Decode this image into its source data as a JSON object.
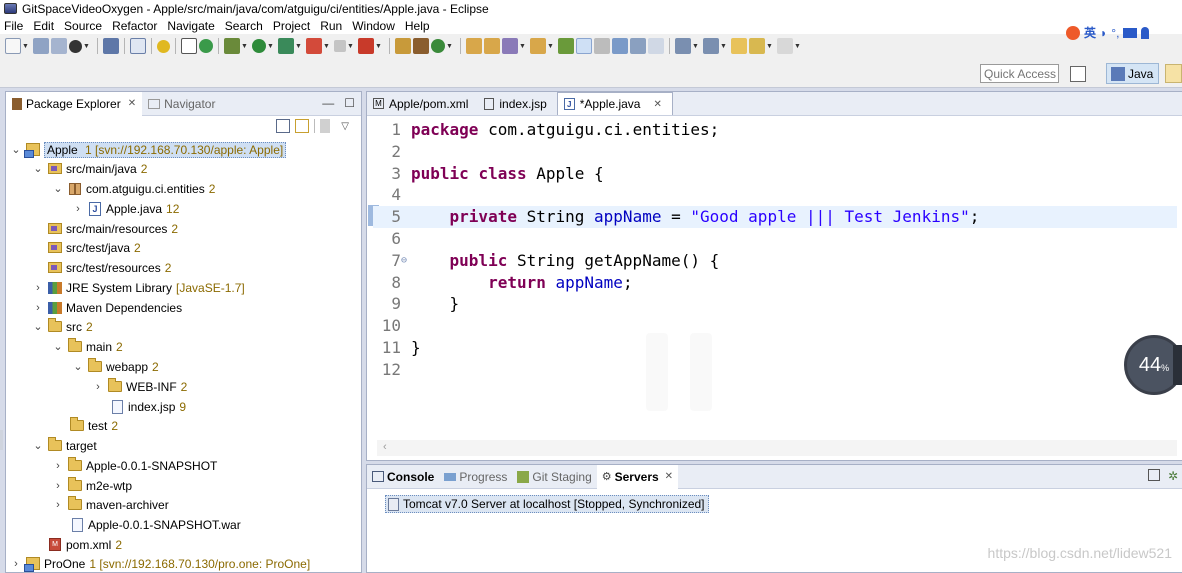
{
  "window": {
    "title": "GitSpaceVideoOxygen - Apple/src/main/java/com/atguigu/ci/entities/Apple.java - Eclipse"
  },
  "menu": [
    "File",
    "Edit",
    "Source",
    "Refactor",
    "Navigate",
    "Search",
    "Project",
    "Run",
    "Window",
    "Help"
  ],
  "ime": {
    "label": "英"
  },
  "quick_access": {
    "placeholder": "Quick Access"
  },
  "perspective": {
    "java_label": "Java"
  },
  "package_explorer": {
    "tab_label": "Package Explorer",
    "navigator_label": "Navigator",
    "tree": [
      {
        "label": "Apple",
        "deco": "1 [svn://192.168.70.130/apple: Apple]",
        "icon": "project",
        "expanded": true,
        "selected": true
      },
      {
        "label": "src/main/java",
        "deco": "2",
        "icon": "srcfolder",
        "expanded": true
      },
      {
        "label": "com.atguigu.ci.entities",
        "deco": "2",
        "icon": "package",
        "expanded": true
      },
      {
        "label": "Apple.java",
        "deco": "12",
        "icon": "java",
        "expanded": false
      },
      {
        "label": "src/main/resources",
        "deco": "2",
        "icon": "srcfolder"
      },
      {
        "label": "src/test/java",
        "deco": "2",
        "icon": "srcfolder"
      },
      {
        "label": "src/test/resources",
        "deco": "2",
        "icon": "srcfolder"
      },
      {
        "label": "JRE System Library",
        "deco": "[JavaSE-1.7]",
        "icon": "lib",
        "expanded": false
      },
      {
        "label": "Maven Dependencies",
        "deco": "",
        "icon": "lib",
        "expanded": false
      },
      {
        "label": "src",
        "deco": "2",
        "icon": "folder",
        "expanded": true
      },
      {
        "label": "main",
        "deco": "2",
        "icon": "folder",
        "expanded": true
      },
      {
        "label": "webapp",
        "deco": "2",
        "icon": "folder",
        "expanded": true
      },
      {
        "label": "WEB-INF",
        "deco": "2",
        "icon": "folder",
        "expanded": false
      },
      {
        "label": "index.jsp",
        "deco": "9",
        "icon": "file"
      },
      {
        "label": "test",
        "deco": "2",
        "icon": "folder"
      },
      {
        "label": "target",
        "deco": "",
        "icon": "folder",
        "expanded": true
      },
      {
        "label": "Apple-0.0.1-SNAPSHOT",
        "deco": "",
        "icon": "folder",
        "expanded": false
      },
      {
        "label": "m2e-wtp",
        "deco": "",
        "icon": "folder",
        "expanded": false
      },
      {
        "label": "maven-archiver",
        "deco": "",
        "icon": "folder",
        "expanded": false
      },
      {
        "label": "Apple-0.0.1-SNAPSHOT.war",
        "deco": "",
        "icon": "file"
      },
      {
        "label": "pom.xml",
        "deco": "2",
        "icon": "xml"
      },
      {
        "label": "ProOne",
        "deco": "1 [svn://192.168.70.130/pro.one: ProOne]",
        "icon": "project",
        "expanded": false
      }
    ]
  },
  "editor": {
    "tabs": [
      {
        "label": "Apple/pom.xml",
        "icon": "M",
        "active": false
      },
      {
        "label": "index.jsp",
        "icon": "jsp",
        "active": false
      },
      {
        "label": "*Apple.java",
        "icon": "J",
        "active": true
      }
    ],
    "lines": {
      "l1_kw": "package",
      "l1_rest": " com.atguigu.ci.entities;",
      "l3_kw1": "public",
      "l3_kw2": "class",
      "l3_rest": " Apple {",
      "l5_kw": "private",
      "l5_type": " String ",
      "l5_field": "appName",
      "l5_eq": " = ",
      "l5_str": "\"Good apple ||| Test Jenkins\"",
      "l5_end": ";",
      "l7_kw": "public",
      "l7_rest": " String getAppName() {",
      "l8_kw": "return",
      "l8_field": "appName",
      "l8_end": ";",
      "l9": "}",
      "l11": "}"
    },
    "line_numbers": [
      "1",
      "2",
      "3",
      "4",
      "5",
      "6",
      "7",
      "8",
      "9",
      "10",
      "11",
      "12"
    ]
  },
  "progress": {
    "value": "44",
    "unit": "%"
  },
  "console": {
    "tabs": [
      {
        "label": "Console",
        "bold": true
      },
      {
        "label": "Progress",
        "bold": false
      },
      {
        "label": "Git Staging",
        "bold": false
      },
      {
        "label": "Servers",
        "bold": true,
        "active": true
      }
    ],
    "server_entry": "Tomcat v7.0 Server at localhost  [Stopped, Synchronized]"
  },
  "watermark": "https://blog.csdn.net/lidew521",
  "colors": {
    "keyword": "#7f0055",
    "field": "#0000c0",
    "string": "#2a00ff",
    "decoration": "#8b6a00",
    "selection": "#cfdff3"
  }
}
